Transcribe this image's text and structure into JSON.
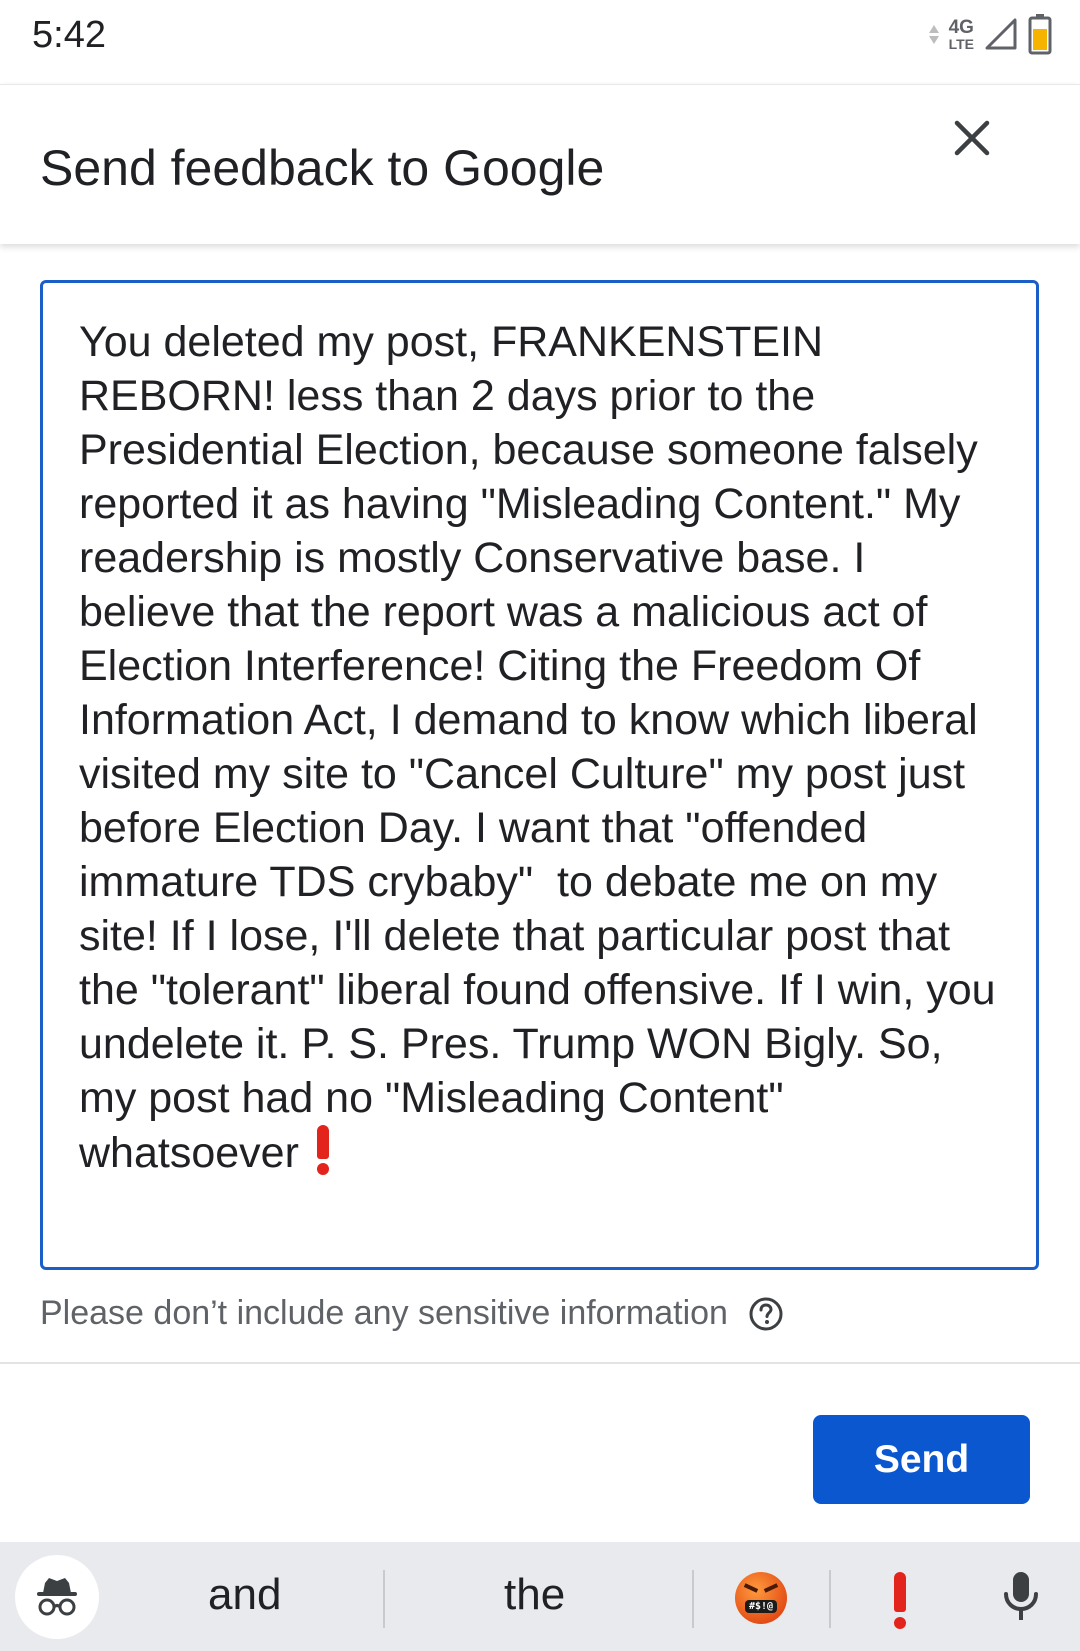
{
  "status_bar": {
    "time": "5:42",
    "network_type": "4G",
    "network_sub": "LTE"
  },
  "header": {
    "title": "Send feedback to Google",
    "close_icon": "close-icon"
  },
  "feedback": {
    "text": "You deleted my post, FRANKENSTEIN REBORN! less than 2 days prior to the Presidential Election, because someone falsely reported it as having \"Misleading Content.\" My readership is mostly Conservative base. I believe that the report was a malicious act of Election Interference! Citing the Freedom Of Information Act, I demand to know which liberal visited my site to \"Cancel Culture\" my post just before Election Day. I want that \"offended immature TDS crybaby\"  to debate me on my site! If I lose, I'll delete that particular post that the \"tolerant\" liberal found offensive. If I win, you undelete it. P. S. Pres. Trump WON Bigly. So, my post had no \"Misleading Content\" whatsoever",
    "trailing_emoji": "red-exclamation-mark"
  },
  "note": {
    "text": "Please don’t include any sensitive information",
    "help_icon": "help-circle-icon"
  },
  "actions": {
    "send_label": "Send"
  },
  "keyboard": {
    "suggestions": [
      "and",
      "the"
    ],
    "emoji_suggestions": [
      "face-with-symbols-on-mouth",
      "red-exclamation-mark"
    ],
    "mouth_symbols": "#$!@",
    "mic_icon": "microphone-icon",
    "incognito_icon": "incognito-icon"
  },
  "colors": {
    "accent": "#0b57d0",
    "text_border": "#1a5fc8",
    "exclaim": "#e3241c",
    "keyboard_bg": "#e8eaed"
  }
}
